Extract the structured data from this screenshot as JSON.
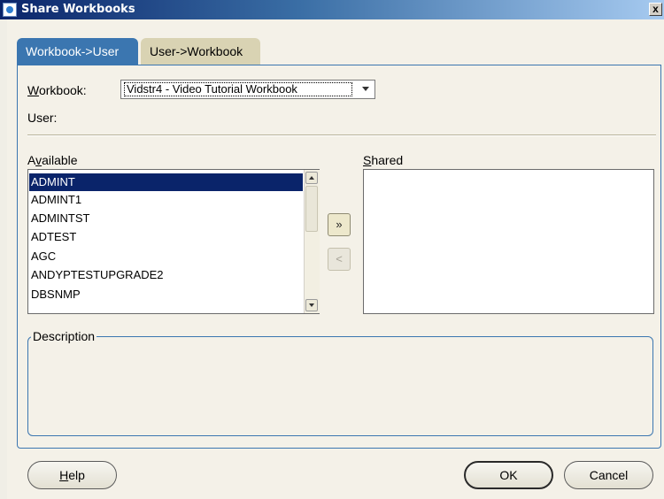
{
  "window": {
    "title": "Share Workbooks",
    "close_glyph": "x",
    "icon": "workbook-icon"
  },
  "tabs": [
    {
      "label": "Workbook->User",
      "active": true
    },
    {
      "label": "User->Workbook",
      "active": false
    }
  ],
  "form": {
    "workbook_label": "Workbook:",
    "workbook_label_accel": "W",
    "workbook_label_rest": "orkbook:",
    "workbook_value": "Vidstr4 - Video Tutorial Workbook",
    "user_label": "User:"
  },
  "available": {
    "label_pre": "A",
    "label_accel": "v",
    "label_post": "ailable",
    "items": [
      "ADMINT",
      "ADMINT1",
      "ADMINTST",
      "ADTEST",
      "AGC",
      "ANDYPTESTUPGRADE2",
      "DBSNMP"
    ],
    "selected_index": 0
  },
  "shared": {
    "label_accel": "S",
    "label_rest": "hared",
    "items": []
  },
  "move_buttons": {
    "move_right_glyph": "»",
    "move_left_glyph": "<"
  },
  "description": {
    "label": "Description",
    "text": ""
  },
  "buttons": {
    "help_accel": "H",
    "help_rest": "elp",
    "ok": "OK",
    "cancel": "Cancel"
  },
  "colors": {
    "accent": "#3b76b0",
    "selection": "#0a246a",
    "tab_inactive": "#d9d3b3"
  }
}
